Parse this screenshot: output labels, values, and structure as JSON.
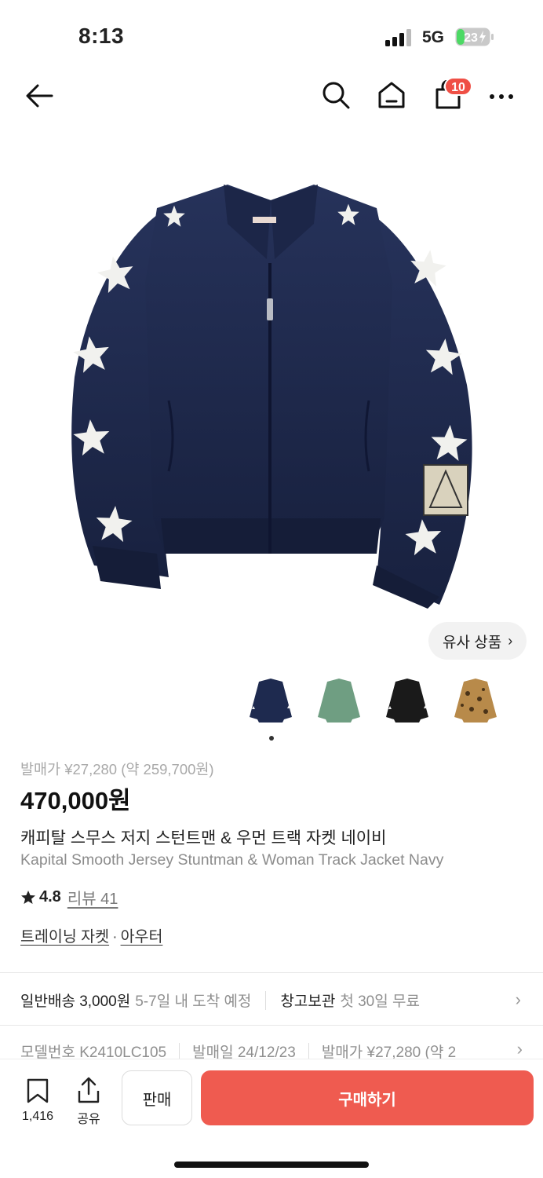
{
  "status_bar": {
    "time": "8:13",
    "network": "5G",
    "battery": "23"
  },
  "nav": {
    "cart_count": "10"
  },
  "similar_button": {
    "label": "유사 상품",
    "chevron": "›"
  },
  "thumbnails": [
    {
      "color": "#1e2a4f",
      "name": "navy"
    },
    {
      "color": "#6f9e82",
      "name": "green"
    },
    {
      "color": "#1a1a1a",
      "name": "black"
    },
    {
      "color": "#b88a4a",
      "name": "leopard"
    }
  ],
  "product": {
    "release_price": "발매가 ¥27,280 (약 259,700원)",
    "price": "470,000원",
    "title_ko": "캐피탈 스무스 저지 스턴트맨 & 우먼 트랙 자켓 네이비",
    "title_en": "Kapital Smooth Jersey Stuntman & Woman Track Jacket Navy",
    "rating": "4.8",
    "review_label": "리뷰 41",
    "category_1": "트레이닝 자켓",
    "category_sep": "·",
    "category_2": "아우터"
  },
  "shipping": {
    "label_1": "일반배송 3,000원",
    "detail_1": "5-7일 내 도착 예정",
    "label_2": "창고보관",
    "detail_2": "첫 30일 무료"
  },
  "meta": {
    "model": "모델번호 K2410LC105",
    "release_date": "발매일 24/12/23",
    "release_price": "발매가 ¥27,280 (약 2"
  },
  "bottom_bar": {
    "bookmark_count": "1,416",
    "share_label": "공유",
    "sell_label": "판매",
    "buy_label": "구매하기"
  },
  "colors": {
    "accent": "#ef5b50",
    "badge": "#ef4f45",
    "jacket": "#1e2a4f"
  }
}
